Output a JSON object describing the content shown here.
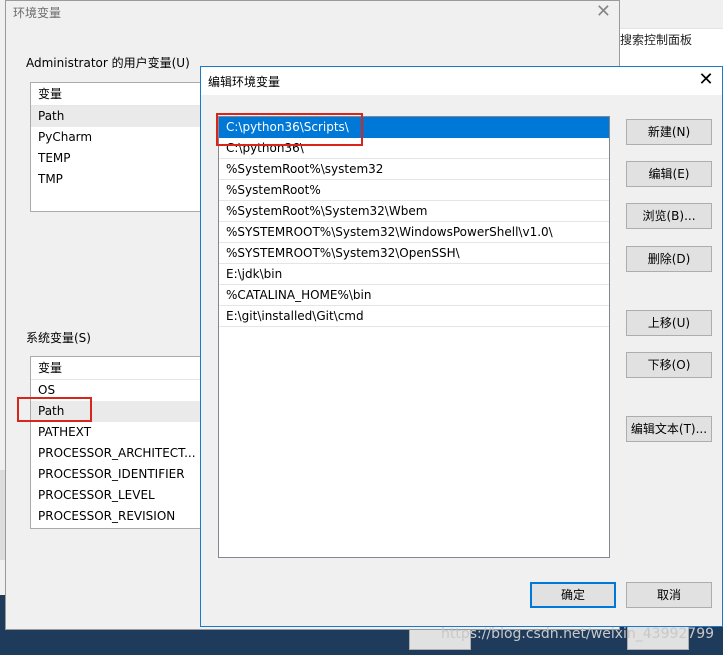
{
  "background": {
    "right_panel_text": "搜索控制面板"
  },
  "env_dialog": {
    "title": "环境变量",
    "user_section_label": "Administrator 的用户变量(U)",
    "user_list": {
      "header": "变量",
      "rows": [
        "Path",
        "PyCharm",
        "TEMP",
        "TMP"
      ],
      "selected_index": 0
    },
    "system_section_label": "系统变量(S)",
    "system_list": {
      "header": "变量",
      "rows": [
        "OS",
        "Path",
        "PATHEXT",
        "PROCESSOR_ARCHITECT...",
        "PROCESSOR_IDENTIFIER",
        "PROCESSOR_LEVEL",
        "PROCESSOR_REVISION"
      ],
      "selected_index": 1
    }
  },
  "edit_dialog": {
    "title": "编辑环境变量",
    "path_entries": [
      "C:\\python36\\Scripts\\",
      "C:\\python36\\",
      "%SystemRoot%\\system32",
      "%SystemRoot%",
      "%SystemRoot%\\System32\\Wbem",
      "%SYSTEMROOT%\\System32\\WindowsPowerShell\\v1.0\\",
      "%SYSTEMROOT%\\System32\\OpenSSH\\",
      "E:\\jdk\\bin",
      "%CATALINA_HOME%\\bin",
      "E:\\git\\installed\\Git\\cmd"
    ],
    "selected_index": 0,
    "buttons": {
      "new": "新建(N)",
      "edit": "编辑(E)",
      "browse": "浏览(B)...",
      "delete": "删除(D)",
      "move_up": "上移(U)",
      "move_down": "下移(O)",
      "edit_text": "编辑文本(T)...",
      "ok": "确定",
      "cancel": "取消"
    }
  },
  "watermark": "https://blog.csdn.net/weixin_43992799",
  "colors": {
    "selection": "#0078d7",
    "highlight_box": "#d9261c"
  }
}
